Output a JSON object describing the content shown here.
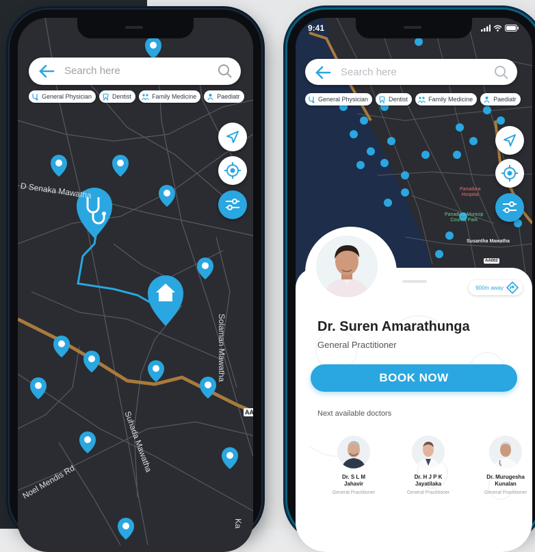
{
  "colors": {
    "accent": "#2aa6e0",
    "map_bg": "#2a2c31",
    "road_primary": "#a97a3c",
    "route_line": "#2aa6e0",
    "pin": "#2aa6e0",
    "map_label_green": "#6fd18a",
    "map_label_red": "#e5736d"
  },
  "left_phone": {
    "search": {
      "placeholder": "Search here"
    },
    "chips": [
      {
        "label": "General Physician",
        "icon": "stethoscope-icon"
      },
      {
        "label": "Dentist",
        "icon": "tooth-icon"
      },
      {
        "label": "Family Medicine",
        "icon": "family-icon"
      },
      {
        "label": "Paediatr",
        "icon": "baby-icon"
      }
    ],
    "fabs": [
      "navigate-icon",
      "locate-icon",
      "filter-icon"
    ],
    "road_labels": {
      "senaka": "D Senaka Mawatha",
      "solaman": "Solaman Mawatha",
      "suhada": "Suhada Mawatha",
      "noel": "Noel Mendis Rd",
      "ka": "Ka"
    },
    "highway_badge": "AA("
  },
  "right_phone": {
    "status_time": "9:41",
    "search": {
      "placeholder": "Search here"
    },
    "chips": [
      {
        "label": "General Physician",
        "icon": "stethoscope-icon"
      },
      {
        "label": "Dentist",
        "icon": "tooth-icon"
      },
      {
        "label": "Family Medicine",
        "icon": "family-icon"
      },
      {
        "label": "Paediatr",
        "icon": "baby-icon"
      }
    ],
    "map_labels": {
      "hospital": "Panadura\nHospital",
      "park": "Panadura Municip\nCouncil Park",
      "susantha": "Susantha Mawatha",
      "badge": "AA002"
    },
    "doctor": {
      "name": "Dr. Suren Amarathunga",
      "role": "General Practitioner",
      "distance": "900m away"
    },
    "book_button": "BOOK NOW",
    "next_title": "Next available doctors",
    "next_doctors": [
      {
        "name_line1": "Dr. S L M",
        "name_line2": "Jahavir",
        "role": "General Practitioner"
      },
      {
        "name_line1": "Dr. H J P K",
        "name_line2": "Jayatilaka",
        "role": "General Practitioner"
      },
      {
        "name_line1": "Dr. Murugesha",
        "name_line2": "Kunalan",
        "role": "General Practitioner"
      }
    ]
  }
}
